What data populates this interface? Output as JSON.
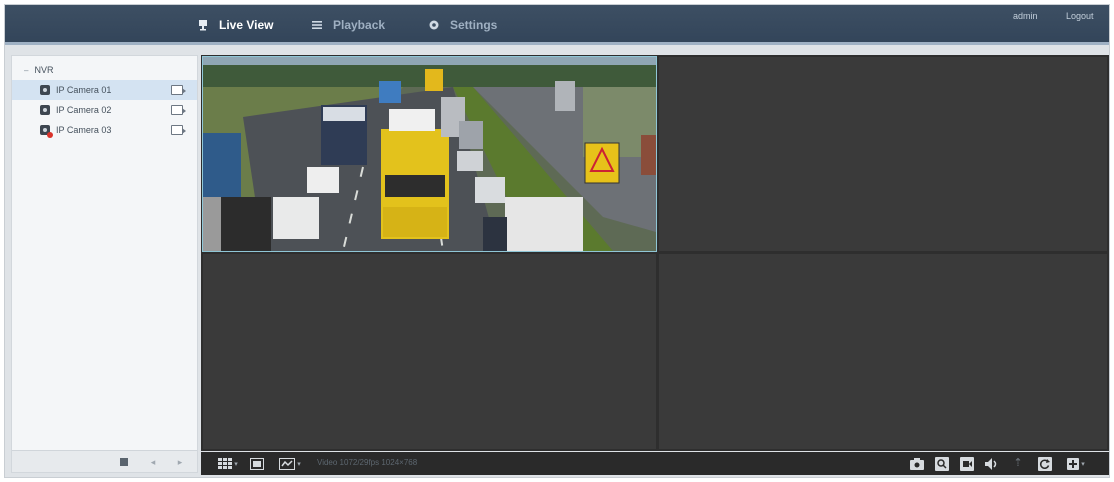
{
  "header": {
    "nav": [
      {
        "label": "Live View",
        "icon": "live-view-icon",
        "active": true
      },
      {
        "label": "Playback",
        "icon": "playback-list-icon",
        "active": false
      },
      {
        "label": "Settings",
        "icon": "gear-icon",
        "active": false
      }
    ],
    "user": "admin",
    "logout": "Logout"
  },
  "sidebar": {
    "root_label": "NVR",
    "cameras": [
      {
        "label": "IP Camera 01",
        "status": "online",
        "selected": true
      },
      {
        "label": "IP Camera 02",
        "status": "online",
        "selected": false
      },
      {
        "label": "IP Camera 03",
        "status": "offline",
        "selected": false
      }
    ]
  },
  "toolbar": {
    "stream_info": "Video 1072/29fps 1024×768"
  },
  "colors": {
    "topbar": "#3d4f63",
    "video_background": "#2e2e2e",
    "selected_row": "#d4e3f2",
    "offline_badge": "#d9332b",
    "active_pane_border": "#8fc6d6"
  }
}
